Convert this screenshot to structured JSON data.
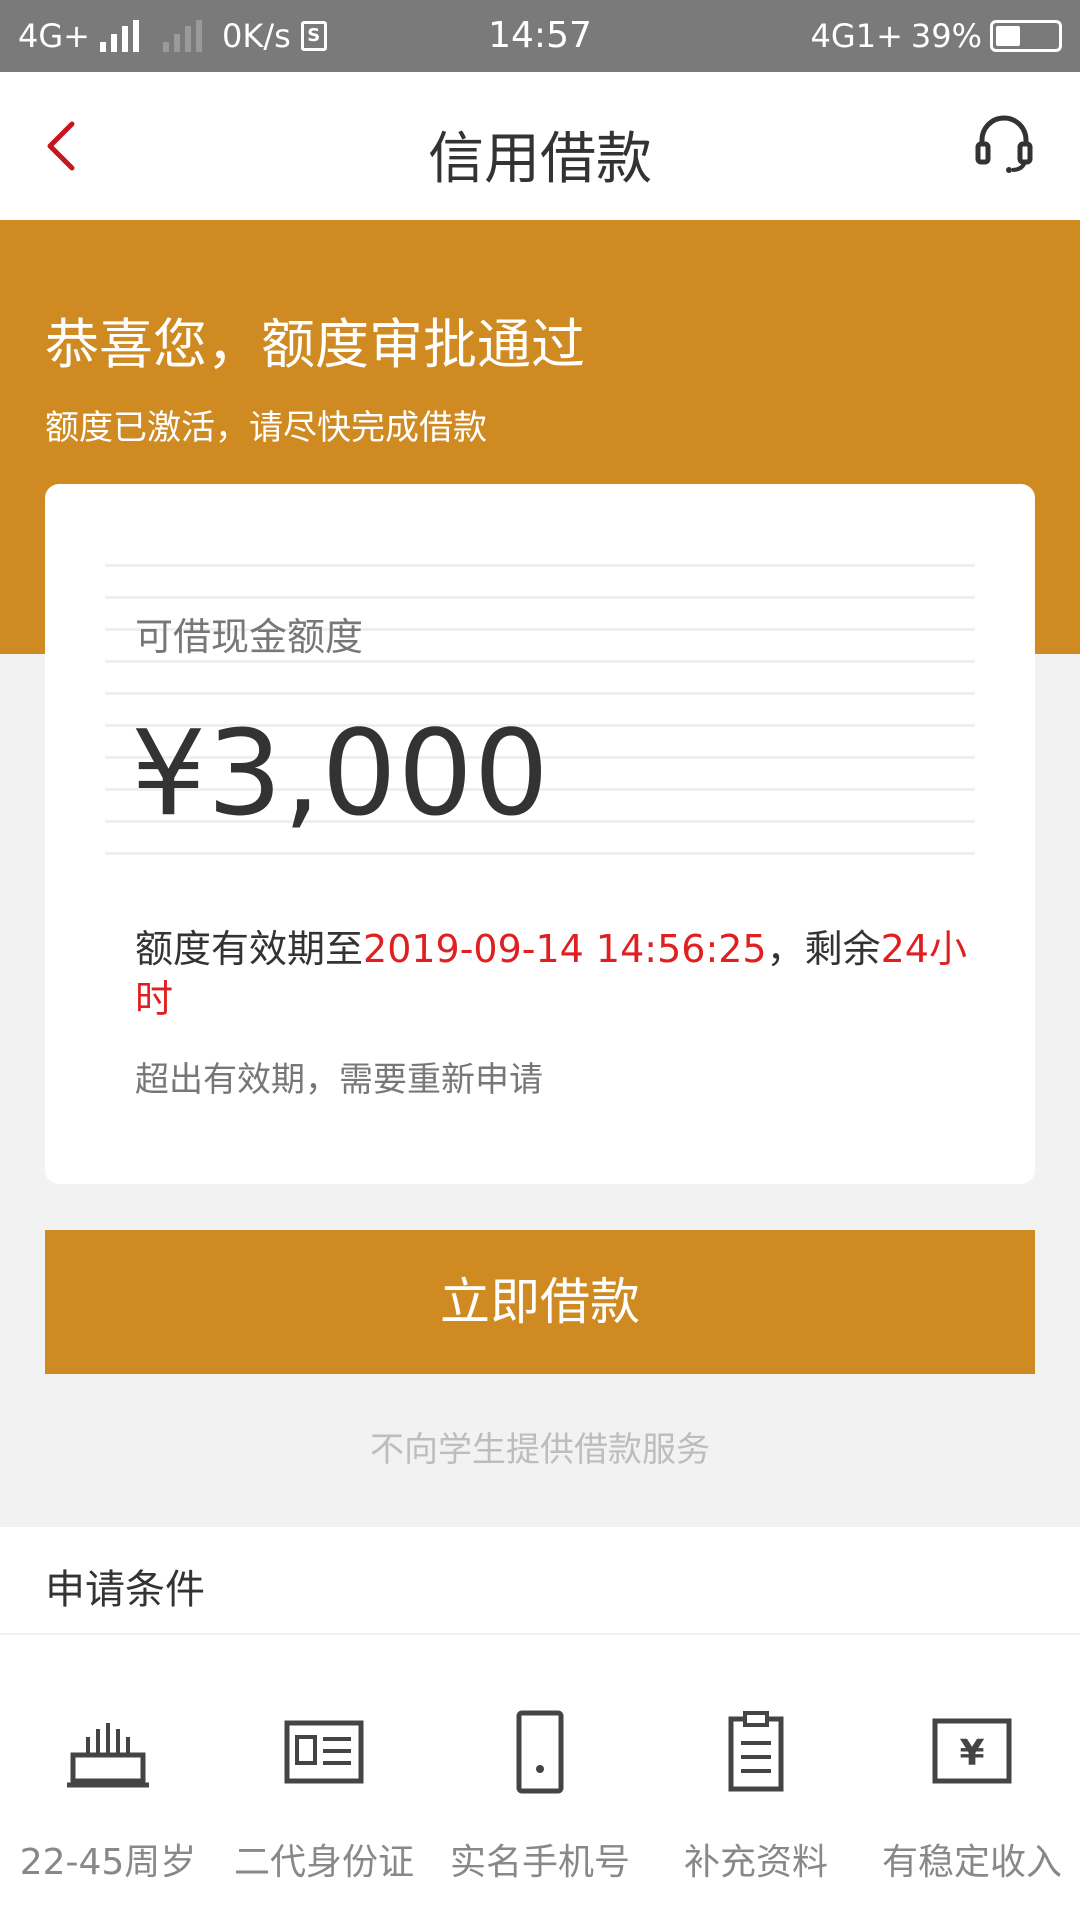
{
  "status_bar": {
    "network_left": "4G+",
    "speed": "0K/s",
    "sim_icon_text": "S",
    "time": "14:57",
    "network_right": "4G1+",
    "battery": "39%"
  },
  "nav": {
    "title": "信用借款",
    "back_icon": "chevron-left-icon",
    "support_icon": "headset-icon"
  },
  "hero": {
    "title": "恭喜您，额度审批通过",
    "subtitle": "额度已激活，请尽快完成借款"
  },
  "card": {
    "amount_label": "可借现金额度",
    "amount": "¥3,000",
    "validity_prefix": "额度有效期至",
    "validity_date": "2019-09-14 14:56:25",
    "validity_mid": "，剩余",
    "validity_remaining": "24小时",
    "note": "超出有效期，需要重新申请"
  },
  "borrow_button": "立即借款",
  "student_note": "不向学生提供借款服务",
  "conditions": {
    "title": "申请条件",
    "items": [
      {
        "label": "22-45周岁",
        "icon": "cake-icon"
      },
      {
        "label": "二代身份证",
        "icon": "id-card-icon"
      },
      {
        "label": "实名手机号",
        "icon": "phone-icon"
      },
      {
        "label": "补充资料",
        "icon": "clipboard-icon"
      },
      {
        "label": "有稳定收入",
        "icon": "income-icon"
      }
    ]
  },
  "colors": {
    "brand": "#d08a22",
    "accent_red": "#e02020",
    "status_bar": "#7a7a7a"
  }
}
